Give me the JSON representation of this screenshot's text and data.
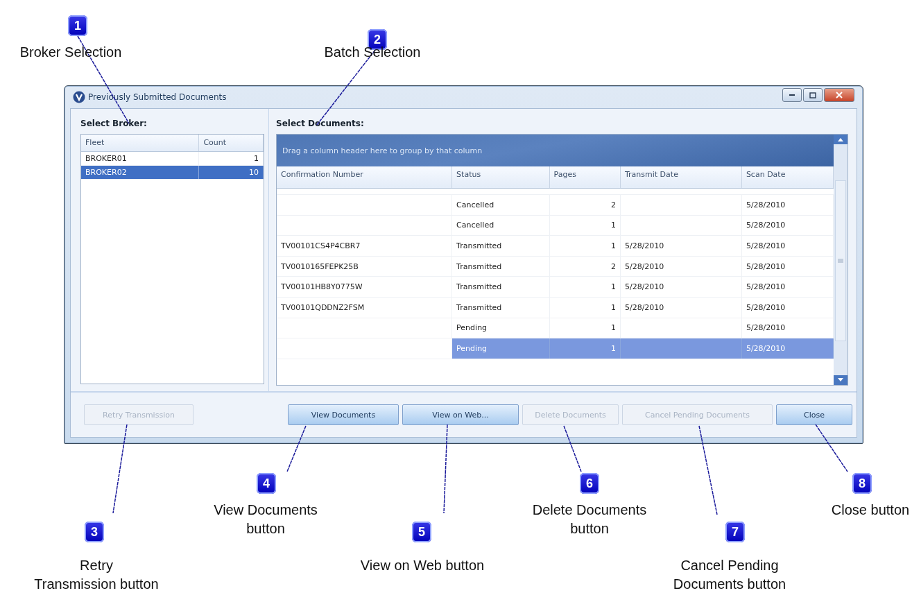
{
  "window": {
    "title": "Previously Submitted Documents"
  },
  "broker_panel": {
    "heading": "Select Broker:",
    "columns": [
      "Fleet",
      "Count"
    ],
    "rows": [
      {
        "fleet": "BROKER01",
        "count": "1",
        "selected": false
      },
      {
        "fleet": "BROKER02",
        "count": "10",
        "selected": true
      }
    ]
  },
  "documents_panel": {
    "heading": "Select Documents:",
    "group_hint": "Drag a column header here to group by that column",
    "columns": [
      "Confirmation Number",
      "Status",
      "Pages",
      "Transmit Date",
      "Scan Date"
    ],
    "rows": [
      {
        "confirmation_number": "",
        "status": "Cancelled",
        "pages": "2",
        "transmit_date": "",
        "scan_date": "5/28/2010",
        "selected": false
      },
      {
        "confirmation_number": "",
        "status": "Cancelled",
        "pages": "1",
        "transmit_date": "",
        "scan_date": "5/28/2010",
        "selected": false
      },
      {
        "confirmation_number": "TV00101CS4P4CBR7",
        "status": "Transmitted",
        "pages": "1",
        "transmit_date": "5/28/2010",
        "scan_date": "5/28/2010",
        "selected": false
      },
      {
        "confirmation_number": "TV0010165FEPK25B",
        "status": "Transmitted",
        "pages": "2",
        "transmit_date": "5/28/2010",
        "scan_date": "5/28/2010",
        "selected": false
      },
      {
        "confirmation_number": "TV00101HB8Y0775W",
        "status": "Transmitted",
        "pages": "1",
        "transmit_date": "5/28/2010",
        "scan_date": "5/28/2010",
        "selected": false
      },
      {
        "confirmation_number": "TV00101QDDNZ2FSM",
        "status": "Transmitted",
        "pages": "1",
        "transmit_date": "5/28/2010",
        "scan_date": "5/28/2010",
        "selected": false
      },
      {
        "confirmation_number": "",
        "status": "Pending",
        "pages": "1",
        "transmit_date": "",
        "scan_date": "5/28/2010",
        "selected": false
      },
      {
        "confirmation_number": "",
        "status": "Pending",
        "pages": "1",
        "transmit_date": "",
        "scan_date": "5/28/2010",
        "selected": true
      }
    ]
  },
  "buttons": [
    {
      "label": "Retry Transmission",
      "disabled": true
    },
    {
      "label": "View Documents",
      "disabled": false
    },
    {
      "label": "View on Web...",
      "disabled": false
    },
    {
      "label": "Delete Documents",
      "disabled": true
    },
    {
      "label": "Cancel Pending Documents",
      "disabled": true
    },
    {
      "label": "Close",
      "disabled": false
    }
  ],
  "callouts": [
    {
      "number": "1",
      "label": "Broker Selection"
    },
    {
      "number": "2",
      "label": "Batch Selection"
    },
    {
      "number": "3",
      "label": "Retry\nTransmission button"
    },
    {
      "number": "4",
      "label": "View Documents\nbutton"
    },
    {
      "number": "5",
      "label": "View on Web button"
    },
    {
      "number": "6",
      "label": "Delete Documents\nbutton"
    },
    {
      "number": "7",
      "label": "Cancel Pending\nDocuments button"
    },
    {
      "number": "8",
      "label": "Close button"
    }
  ]
}
